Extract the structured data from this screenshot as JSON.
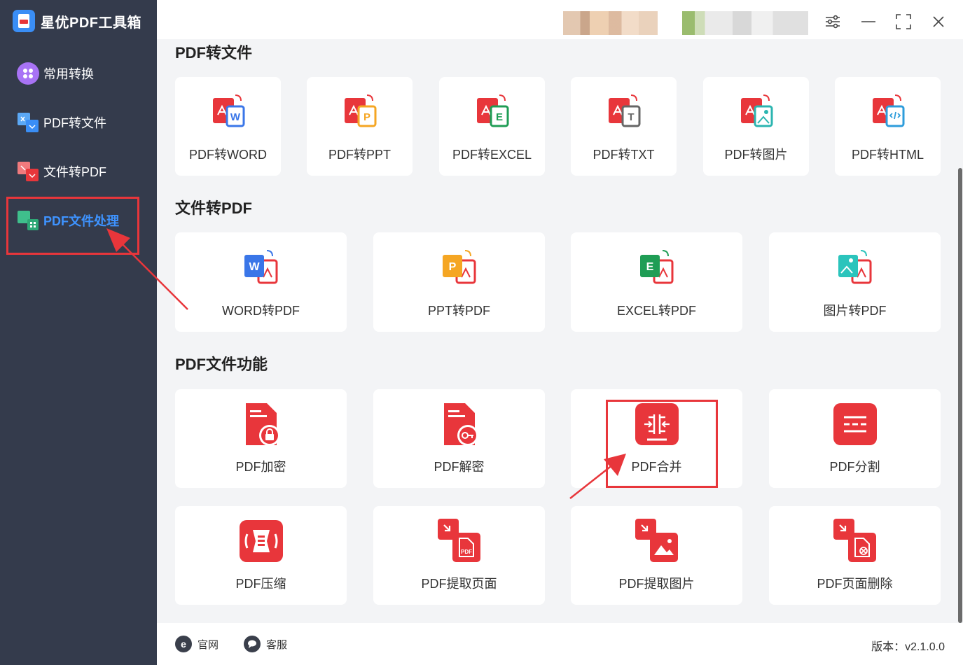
{
  "app": {
    "title": "星优PDF工具箱",
    "version": "版本：v2.1.0.0"
  },
  "sidebar": {
    "items": [
      {
        "label": "常用转换"
      },
      {
        "label": "PDF转文件"
      },
      {
        "label": "文件转PDF"
      },
      {
        "label": "PDF文件处理"
      }
    ]
  },
  "sections": {
    "pdf_to_file": {
      "title": "PDF转文件",
      "items": [
        "PDF转WORD",
        "PDF转PPT",
        "PDF转EXCEL",
        "PDF转TXT",
        "PDF转图片",
        "PDF转HTML"
      ]
    },
    "file_to_pdf": {
      "title": "文件转PDF",
      "items": [
        "WORD转PDF",
        "PPT转PDF",
        "EXCEL转PDF",
        "图片转PDF"
      ]
    },
    "pdf_functions": {
      "title": "PDF文件功能",
      "items": [
        "PDF加密",
        "PDF解密",
        "PDF合并",
        "PDF分割",
        "PDF压缩",
        "PDF提取页面",
        "PDF提取图片",
        "PDF页面删除"
      ]
    }
  },
  "footer": {
    "website": "官网",
    "support": "客服"
  },
  "colors": {
    "sidebar": "#343b4c",
    "accent": "#3e93ff",
    "brand_red": "#e8363b"
  }
}
